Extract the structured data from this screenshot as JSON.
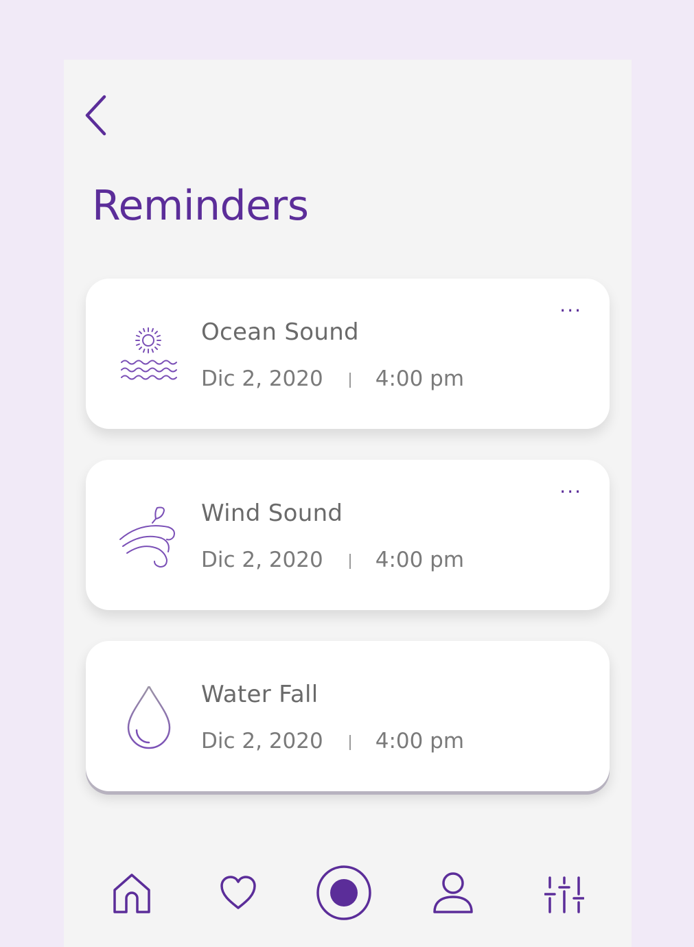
{
  "header": {
    "title": "Reminders"
  },
  "reminders": [
    {
      "name": "Ocean Sound",
      "date": "Dic 2, 2020",
      "time": "4:00 pm",
      "icon": "ocean-icon",
      "more": "..."
    },
    {
      "name": "Wind Sound",
      "date": "Dic 2, 2020",
      "time": "4:00 pm",
      "icon": "wind-icon",
      "more": "..."
    },
    {
      "name": "Water Fall",
      "date": "Dic 2, 2020",
      "time": "4:00 pm",
      "icon": "water-drop-icon"
    }
  ],
  "nav": [
    "home-icon",
    "heart-icon",
    "record-icon",
    "profile-icon",
    "settings-sliders-icon"
  ],
  "colors": {
    "accent": "#5b2d99",
    "background": "#f1eaf7",
    "panel": "#f4f4f4",
    "text": "#6a6a6a"
  }
}
